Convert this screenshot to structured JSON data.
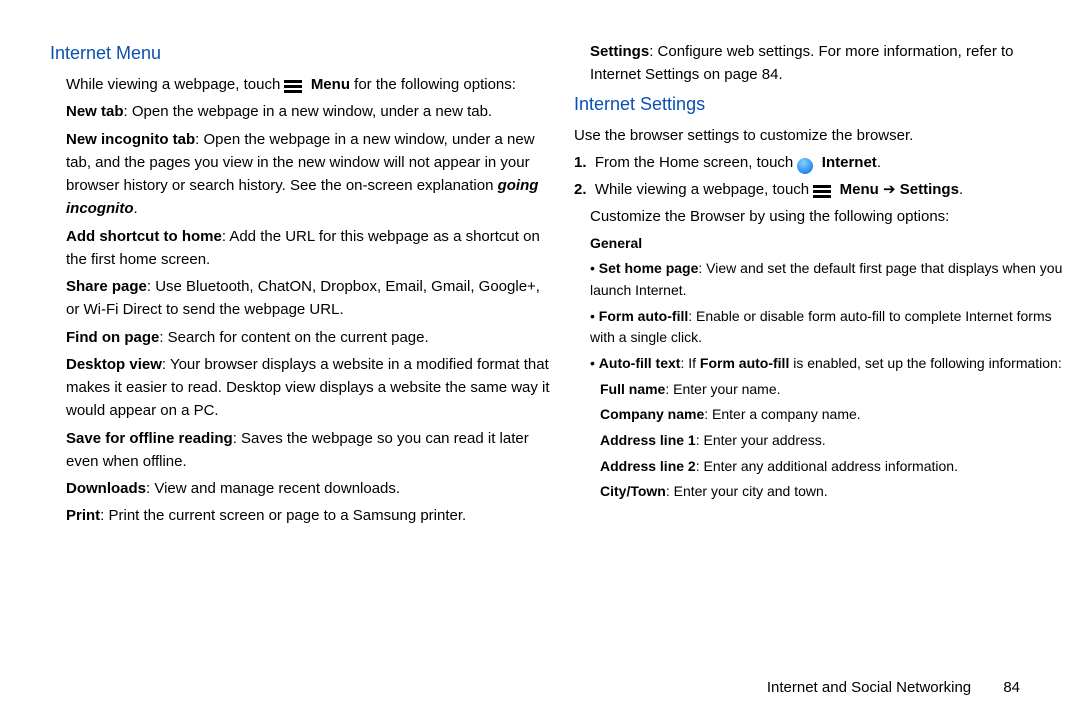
{
  "left": {
    "heading": "Internet Menu",
    "intro_a": "While viewing a webpage, touch ",
    "intro_menu": "Menu",
    "intro_b": " for the following options:",
    "new_tab_b": "New tab",
    "new_tab_t": ": Open the webpage in a new window, under a new tab.",
    "incog_b": "New incognito tab",
    "incog_t": ": Open the webpage in a new window, under a new tab, and the pages you view in the new window will not appear in your browser history or search history. See the on-screen explanation ",
    "incog_i": "going incognito",
    "incog_dot": ".",
    "addsh_b": "Add shortcut to home",
    "addsh_t": ": Add the URL for this webpage as a shortcut on the first home screen.",
    "share_b": "Share page",
    "share_t": ": Use Bluetooth, ChatON, Dropbox, Email, Gmail, Google+, or Wi-Fi Direct to send the webpage URL.",
    "find_b": "Find on page",
    "find_t": ": Search for content on the current page.",
    "desk_b": "Desktop view",
    "desk_t": ": Your browser displays a website in a modified format that makes it easier to read. Desktop view displays a website the same way it would appear on a PC.",
    "save_b": "Save for offline reading",
    "save_t": ": Saves the webpage so you can read it later even when offline.",
    "down_b": "Downloads",
    "down_t": ": View and manage recent downloads.",
    "print_b": "Print",
    "print_t": ": Print the current screen or page to a Samsung printer."
  },
  "right": {
    "top_sett_b": "Settings",
    "top_sett_t1": ": Configure web settings. For more information, refer to ",
    "top_sett_t2": "Internet Settings on page 84.",
    "heading": "Internet Settings",
    "intro": "Use the browser settings to customize the browser.",
    "step1_a": "From the Home screen, touch ",
    "step1_b": "Internet",
    "step1_dot": ".",
    "step1_num": "1.",
    "step2_num": "2.",
    "step2_a": "While viewing a webpage, touch ",
    "step2_menu": "Menu",
    "step2_arrow": " ➔ ",
    "step2_sett": "Settings",
    "step2_dot": ".",
    "step2_c": "Customize the Browser by using the following options:",
    "general_h": "General",
    "shp_b": "Set home page",
    "shp_t": ": View and set the default first page that displays when you launch Internet.",
    "faf_b": "Form auto-fill",
    "faf_t": ": Enable or disable form auto-fill to complete Internet forms with a single click.",
    "aft_b": "Auto-fill text",
    "aft_t1": ": If ",
    "aft_b2": "Form auto-fill",
    "aft_t2": " is enabled, set up the following information:",
    "fn_b": "Full name",
    "fn_t": ": Enter your name.",
    "cn_b": "Company name",
    "cn_t": ": Enter a company name.",
    "a1_b": "Address line 1",
    "a1_t": ": Enter your address.",
    "a2_b": "Address line 2",
    "a2_t": ": Enter any additional address information.",
    "ct_b": "City/Town",
    "ct_t": ": Enter your city and town."
  },
  "footer": {
    "section": "Internet and Social Networking",
    "page": "84"
  }
}
